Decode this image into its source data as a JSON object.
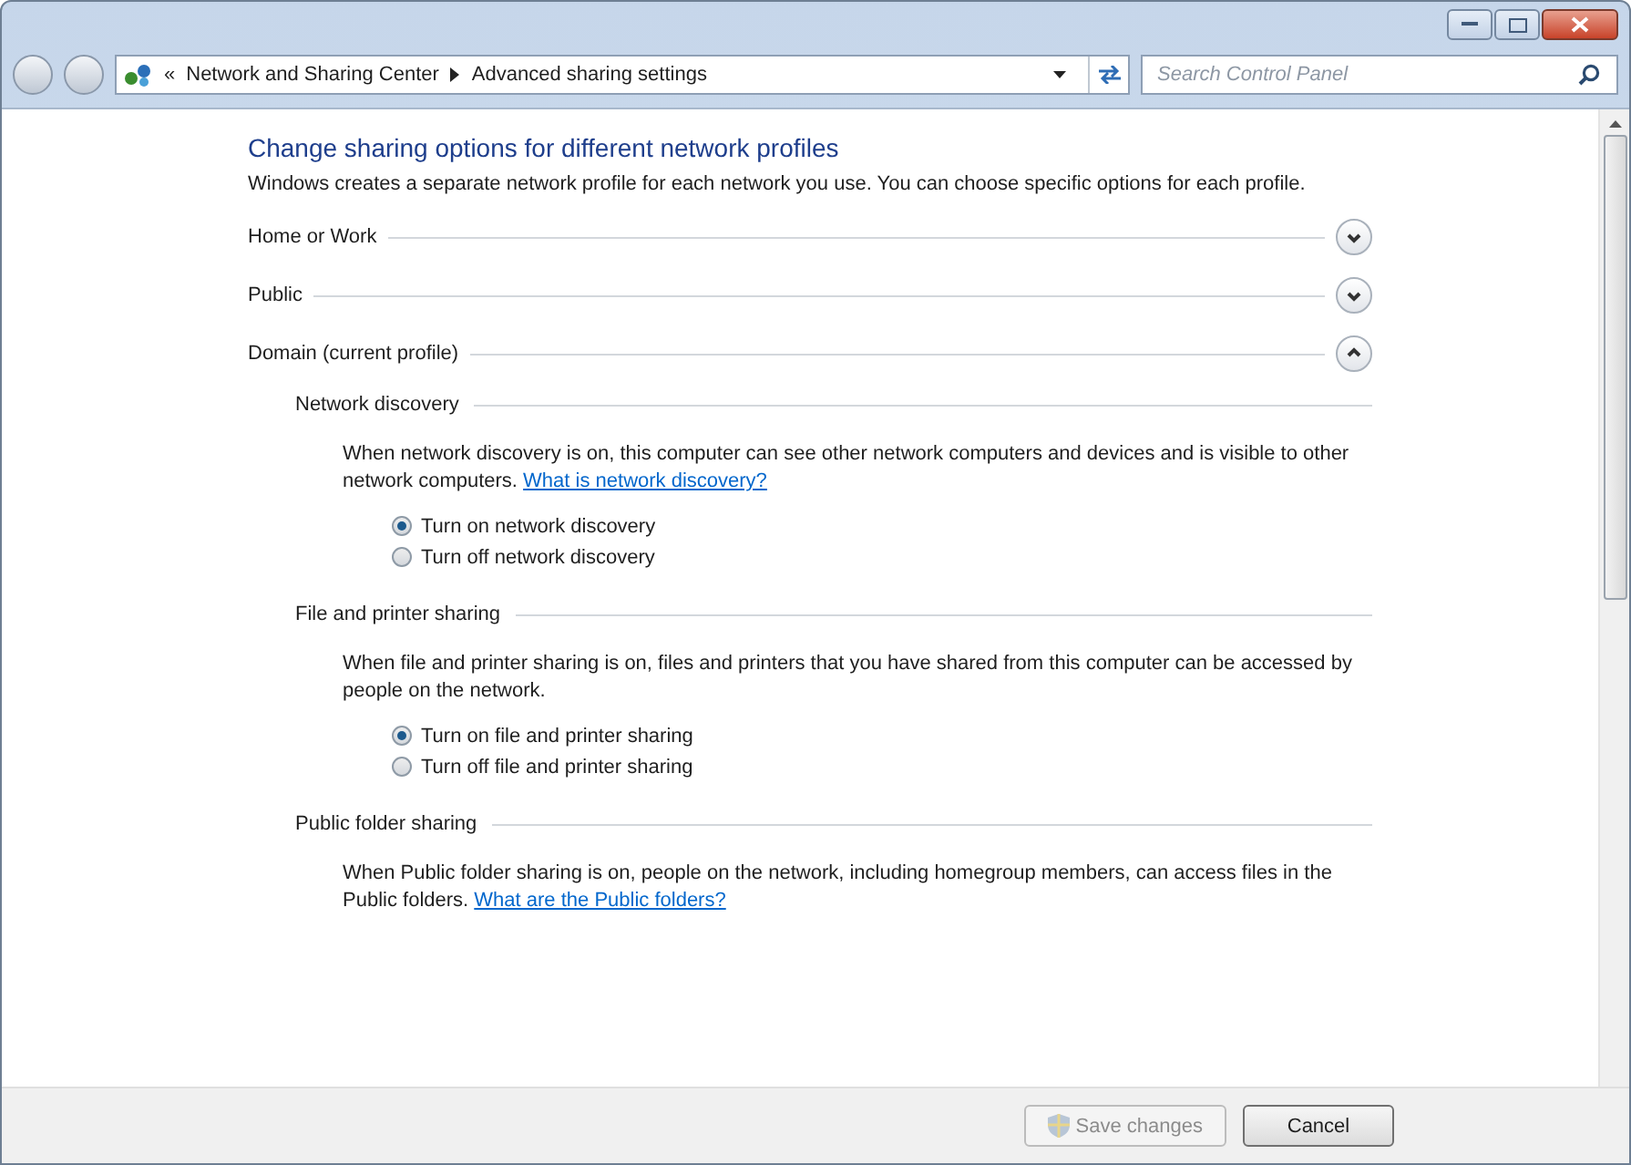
{
  "address_bar": {
    "breadcrumb": [
      "Network and Sharing Center",
      "Advanced sharing settings"
    ],
    "overflow": "«"
  },
  "search": {
    "placeholder": "Search Control Panel"
  },
  "heading": "Change sharing options for different network profiles",
  "intro": "Windows creates a separate network profile for each network you use. You can choose specific options for each profile.",
  "profiles": [
    {
      "name": "Home or Work",
      "expanded": false
    },
    {
      "name": "Public",
      "expanded": false
    },
    {
      "name": "Domain (current profile)",
      "expanded": true,
      "sections": [
        {
          "title": "Network discovery",
          "description": "When network discovery is on, this computer can see other network computers and devices and is visible to other network computers.",
          "link": "What is network discovery?",
          "options": [
            {
              "label": "Turn on network discovery",
              "selected": true
            },
            {
              "label": "Turn off network discovery",
              "selected": false
            }
          ]
        },
        {
          "title": "File and printer sharing",
          "description": "When file and printer sharing is on, files and printers that you have shared from this computer can be accessed by people on the network.",
          "options": [
            {
              "label": "Turn on file and printer sharing",
              "selected": true
            },
            {
              "label": "Turn off file and printer sharing",
              "selected": false
            }
          ]
        },
        {
          "title": "Public folder sharing",
          "description": "When Public folder sharing is on, people on the network, including homegroup members, can access files in the Public folders.",
          "link": "What are the Public folders?"
        }
      ]
    }
  ],
  "buttons": [
    {
      "label": "Save changes",
      "disabled": true,
      "kind": "shield"
    },
    {
      "label": "Cancel",
      "disabled": false,
      "kind": "plain"
    }
  ]
}
